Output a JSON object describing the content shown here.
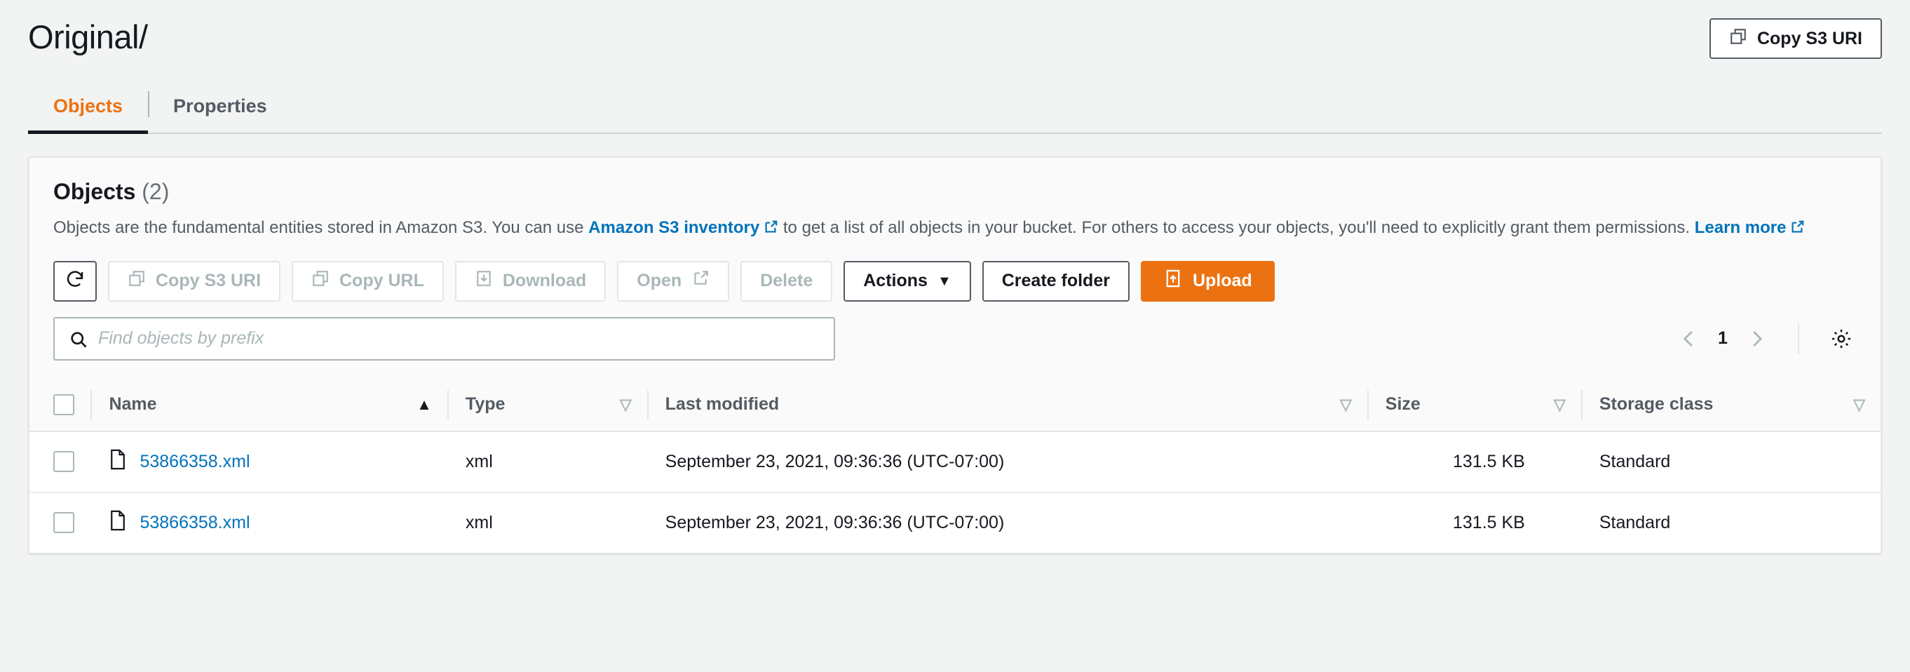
{
  "header": {
    "title": "Original/",
    "copy_uri_button": "Copy S3 URI"
  },
  "tabs": [
    {
      "label": "Objects",
      "active": true
    },
    {
      "label": "Properties",
      "active": false
    }
  ],
  "objects_panel": {
    "title": "Objects",
    "count": "(2)",
    "description_part1": "Objects are the fundamental entities stored in Amazon S3. You can use ",
    "inventory_link": "Amazon S3 inventory",
    "description_part2": " to get a list of all objects in your bucket. For others to access your objects, you'll need to explicitly grant them permissions. ",
    "learn_more_link": "Learn more",
    "toolbar": {
      "refresh_label": "Refresh",
      "copy_s3_uri": "Copy S3 URI",
      "copy_url": "Copy URL",
      "download": "Download",
      "open": "Open",
      "delete": "Delete",
      "actions": "Actions",
      "actions_caret": "▼",
      "create_folder": "Create folder",
      "upload": "Upload"
    },
    "search": {
      "placeholder": "Find objects by prefix",
      "value": ""
    },
    "pagination": {
      "prev": "‹",
      "page": "1",
      "next": "›"
    },
    "table": {
      "columns": [
        {
          "label": "Name",
          "sort": "asc"
        },
        {
          "label": "Type",
          "sort": "none"
        },
        {
          "label": "Last modified",
          "sort": "none"
        },
        {
          "label": "Size",
          "sort": "none"
        },
        {
          "label": "Storage class",
          "sort": "none"
        }
      ],
      "rows": [
        {
          "name": "53866358.xml",
          "type": "xml",
          "last_modified": "September 23, 2021, 09:36:36 (UTC-07:00)",
          "size": "131.5 KB",
          "storage_class": "Standard"
        },
        {
          "name": "53866358.xml",
          "type": "xml",
          "last_modified": "September 23, 2021, 09:36:36 (UTC-07:00)",
          "size": "131.5 KB",
          "storage_class": "Standard"
        }
      ]
    }
  },
  "colors": {
    "accent_orange": "#ec7211",
    "link_blue": "#0073bb",
    "page_bg": "#f2f3f3",
    "disabled_gray": "#aab7b8"
  }
}
